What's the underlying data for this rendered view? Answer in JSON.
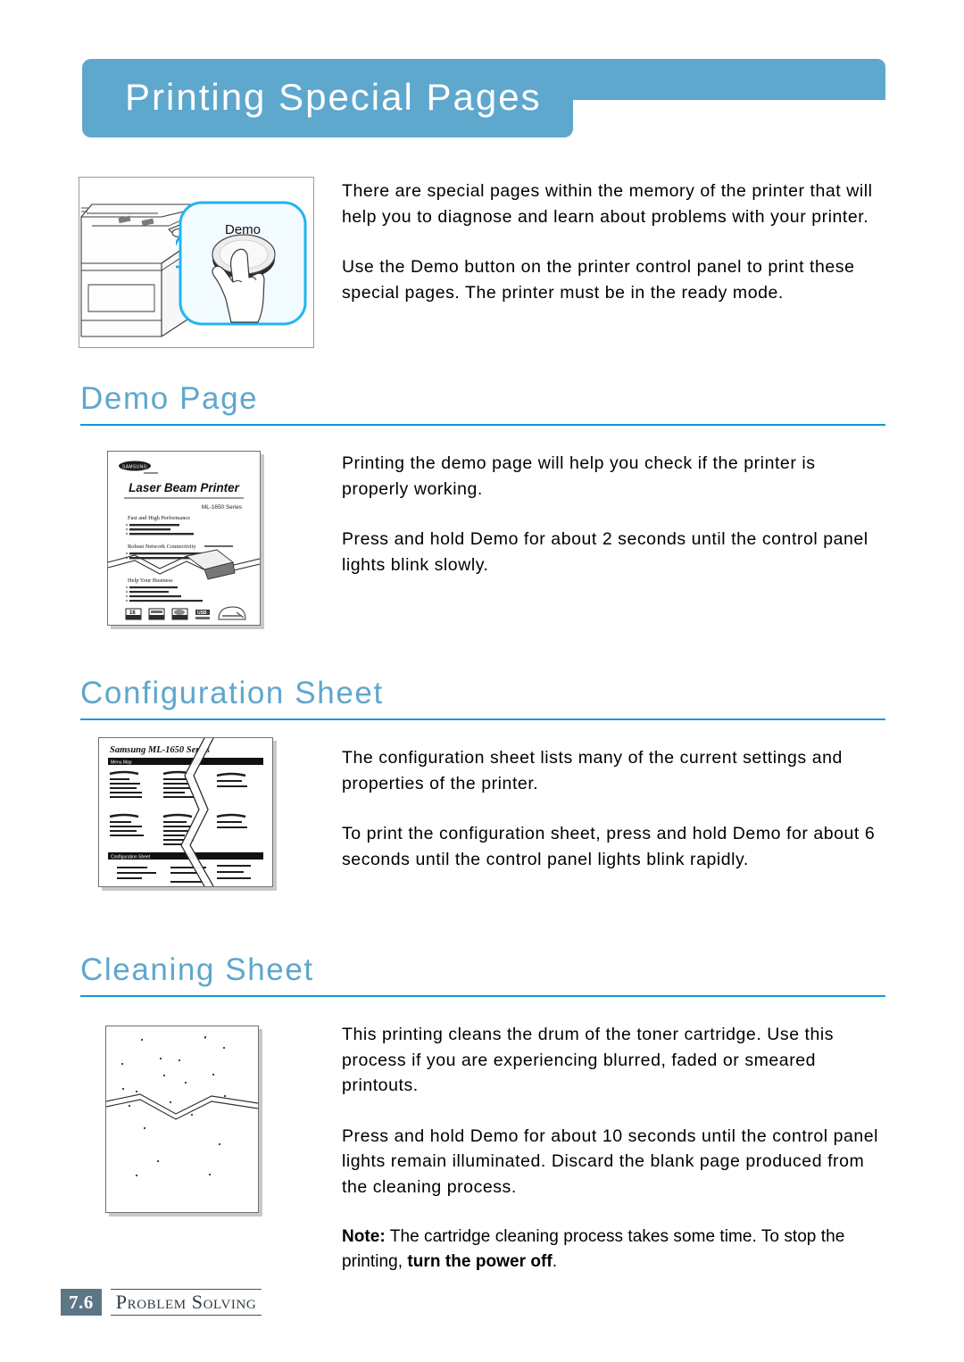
{
  "page": {
    "banner_title": "Printing Special Pages",
    "background_color": "#ffffff",
    "accent_color": "#5ea7cd",
    "rule_color": "#0c9ad8"
  },
  "intro": {
    "paragraph_1": "There are special pages within the memory of the printer that will help you to diagnose and learn about problems with your printer.",
    "paragraph_2": "Use the Demo button on the printer control panel to print these special pages. The printer must be in the ready mode."
  },
  "figure_printer": {
    "callout_label": "Demo",
    "caption": "printer-control-panel-with-demo-button"
  },
  "sections": [
    {
      "id": "demo-page",
      "heading": "Demo Page",
      "paragraph_1": "Printing the demo page will help you check if the printer is properly working.",
      "paragraph_2": "Press and hold Demo for about 2 seconds until the control panel lights blink slowly."
    },
    {
      "id": "configuration-sheet",
      "heading": "Configuration Sheet",
      "paragraph_1": "The configuration sheet lists many of the current settings and properties of the printer.",
      "paragraph_2": "To print the configuration sheet, press and hold Demo for about 6 seconds until the control panel lights blink rapidly."
    },
    {
      "id": "cleaning-sheet",
      "heading": "Cleaning Sheet",
      "paragraph_1": "This printing cleans the drum of the toner cartridge. Use this process if you are experiencing blurred, faded or smeared printouts.",
      "paragraph_2": "Press and hold Demo for about 10 seconds until the control panel lights remain illuminated. Discard the blank page produced from the cleaning process.",
      "note": {
        "label": "Note:",
        "text_before_bold": " The cartridge cleaning process takes some time. To stop the printing, ",
        "bold_text": "turn the power off",
        "text_after_bold": "."
      }
    }
  ],
  "figure_demo_page": {
    "brand": "SAMSUNG",
    "title": "Laser Beam Printer",
    "model": "ML-1650 Series",
    "feature_1": "Fast and High Performance",
    "feature_2": "Robust Network Connectivity",
    "feature_3": "Help Your Business",
    "badges": [
      "16",
      "1200",
      "PCL",
      "USB",
      "ENERGY"
    ]
  },
  "figure_config_sheet": {
    "title": "Samsung ML-1650 Series",
    "bar_1": "Menu Map",
    "bar_2": "Configuration Sheet"
  },
  "figure_cleaning_sheet": {
    "caption": "blank-page-with-toner-specks"
  },
  "footer": {
    "page_number": "7.6",
    "section_name": "Problem Solving",
    "number_box_color": "#5d7685"
  }
}
